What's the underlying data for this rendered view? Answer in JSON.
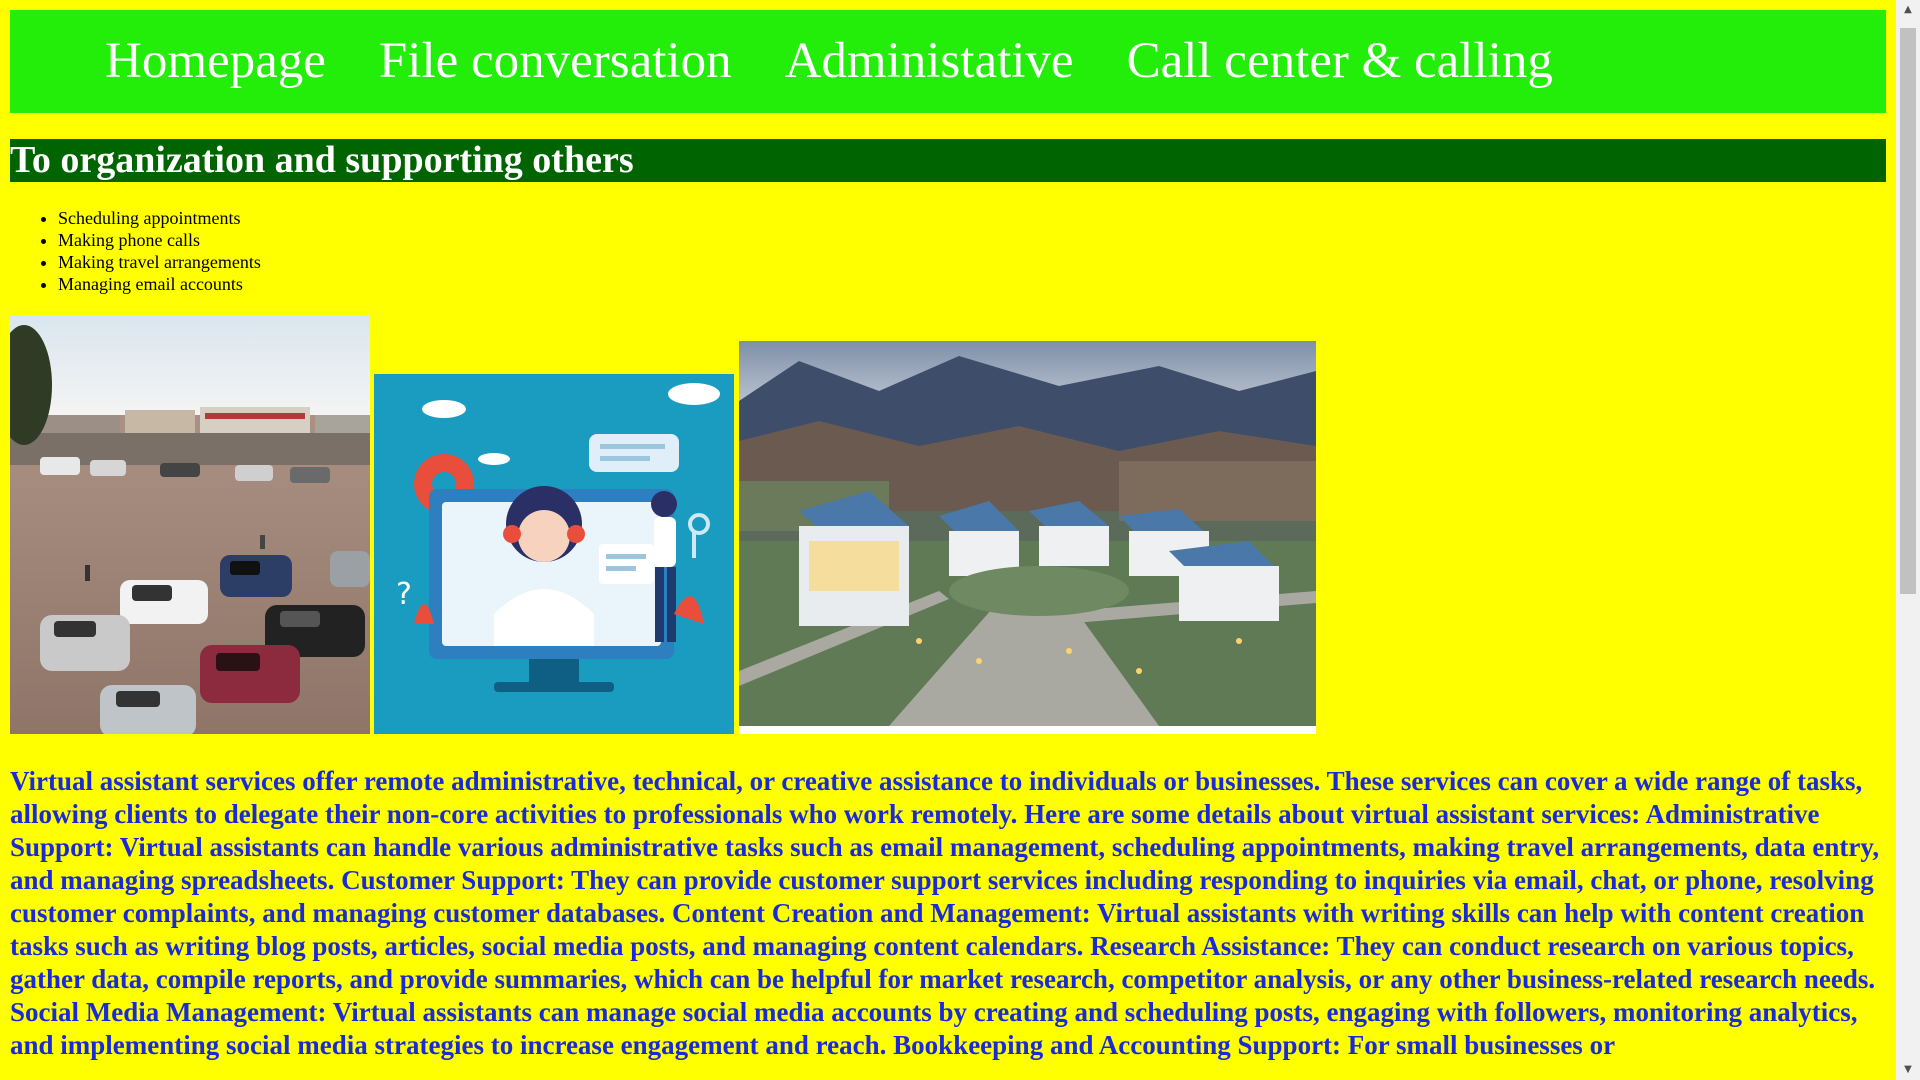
{
  "nav": {
    "items": [
      {
        "label": "Homepage"
      },
      {
        "label": "File conversation"
      },
      {
        "label": "Administative"
      },
      {
        "label": "Call center & calling"
      }
    ]
  },
  "heading": "To organization and supporting others",
  "tasks": [
    "Scheduling appointments",
    "Making phone calls",
    "Making travel arrangements",
    "Managing email accounts"
  ],
  "description": "Virtual assistant services offer remote administrative, technical, or creative assistance to individuals or businesses. These services can cover a wide range of tasks, allowing clients to delegate their non-core activities to professionals who work remotely. Here are some details about virtual assistant services: Administrative Support: Virtual assistants can handle various administrative tasks such as email management, scheduling appointments, making travel arrangements, data entry, and managing spreadsheets. Customer Support: They can provide customer support services including responding to inquiries via email, chat, or phone, resolving customer complaints, and managing customer databases. Content Creation and Management: Virtual assistants with writing skills can help with content creation tasks such as writing blog posts, articles, social media posts, and managing content calendars. Research Assistance: They can conduct research on various topics, gather data, compile reports, and provide summaries, which can be helpful for market research, competitor analysis, or any other business-related research needs. Social Media Management: Virtual assistants can manage social media accounts by creating and scheduling posts, engaging with followers, monitoring analytics, and implementing social media strategies to increase engagement and reach. Bookkeeping and Accounting Support: For small businesses or",
  "images": [
    {
      "icon": "street-parking-photo"
    },
    {
      "icon": "call-center-illustration"
    },
    {
      "icon": "campus-building-photo"
    }
  ],
  "colors": {
    "page_background": "#ffff00",
    "nav_background": "#22ee0a",
    "heading_background": "#006400",
    "description_text": "#1a2ad9"
  }
}
